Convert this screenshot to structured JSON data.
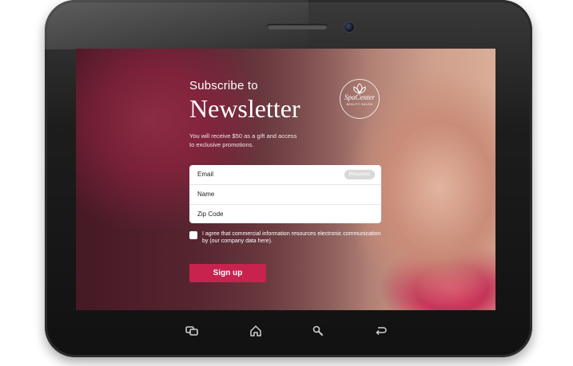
{
  "newsletter": {
    "subtitle": "Subscribe to",
    "title": "Newsletter",
    "description": "You will receive $50 as a gift and access to exclusive promotions."
  },
  "logo": {
    "name": "SpaCenter",
    "tagline": "BEAUTY SALON"
  },
  "form": {
    "email_label": "Email",
    "email_badge": "Required",
    "name_label": "Name",
    "zip_label": "Zip Code"
  },
  "consent": {
    "checked": false,
    "text": "I agree that commercial information resources electronic communication by (our company data here)."
  },
  "signup": {
    "label": "Sign up"
  },
  "colors": {
    "accent": "#c8224e",
    "bezel": "#1d1d1d"
  },
  "device_nav": {
    "icons": [
      "recent-apps-icon",
      "home-icon",
      "search-icon",
      "back-icon"
    ]
  }
}
